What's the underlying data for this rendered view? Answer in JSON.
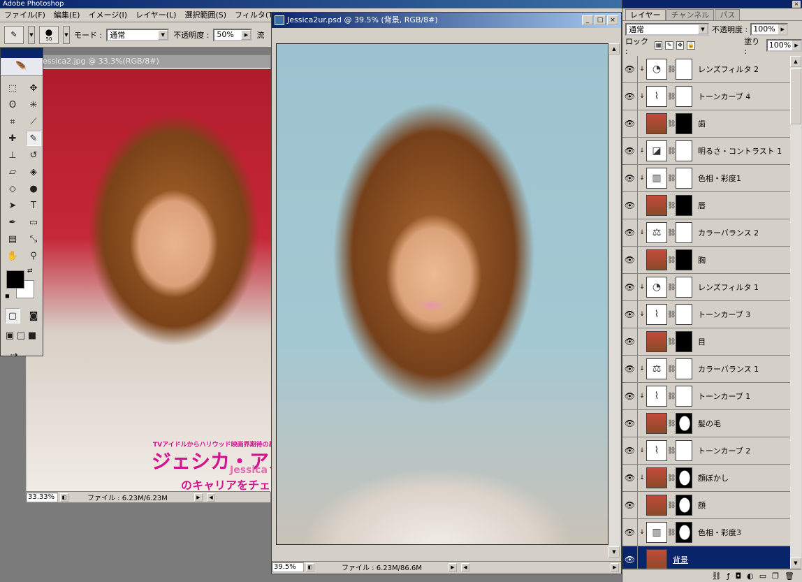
{
  "app": {
    "title": "Adobe Photoshop"
  },
  "menu": [
    "ファイル(F)",
    "編集(E)",
    "イメージ(I)",
    "レイヤー(L)",
    "選択範囲(S)",
    "フィルタ(T)"
  ],
  "options": {
    "brush_size": "50",
    "mode_label": "モード :",
    "mode_value": "通常",
    "opacity_label": "不透明度 :",
    "opacity_value": "50%",
    "flow_label": "流"
  },
  "doc1": {
    "title": "essica2.jpg @ 33.3%(RGB/8#)",
    "zoom": "33.33%",
    "file_info": "ファイル : 6.23M/6.23M",
    "magazine": {
      "small": "TVアイドルからハリウッド映画界期待の星",
      "big": "ジェシカ・アル",
      "english": "Jessica A",
      "sub": "のキャリアをチェッ"
    }
  },
  "doc2": {
    "title": "Jessica2ur.psd @ 39.5% (背景, RGB/8#)",
    "zoom": "39.5%",
    "file_info": "ファイル : 6.23M/86.6M"
  },
  "layers_panel": {
    "tabs": [
      "レイヤー",
      "チャンネル",
      "パス"
    ],
    "blend_mode": "通常",
    "opacity_label": "不透明度 :",
    "opacity_value": "100%",
    "lock_label": "ロック :",
    "fill_label": "塗り :",
    "fill_value": "100%",
    "layers": [
      {
        "name": "レンズフィルタ 2",
        "kind": "adj",
        "icon": "lens-filter-icon",
        "mask": "white",
        "clipped": true
      },
      {
        "name": "トーンカーブ 4",
        "kind": "adj",
        "icon": "curves-icon",
        "mask": "white",
        "clipped": true
      },
      {
        "name": "歯",
        "kind": "img",
        "icon": "photo-thumbnail",
        "mask": "black",
        "clipped": false
      },
      {
        "name": "明るさ・コントラスト 1",
        "kind": "adj",
        "icon": "brightness-contrast-icon",
        "mask": "white",
        "clipped": true
      },
      {
        "name": "色相・彩度1",
        "kind": "adj",
        "icon": "hue-saturation-icon",
        "mask": "white",
        "clipped": true
      },
      {
        "name": "唇",
        "kind": "img",
        "icon": "photo-thumbnail",
        "mask": "black",
        "clipped": false
      },
      {
        "name": "カラーバランス 2",
        "kind": "adj",
        "icon": "color-balance-icon",
        "mask": "white",
        "clipped": true
      },
      {
        "name": "胸",
        "kind": "img",
        "icon": "photo-thumbnail",
        "mask": "black",
        "clipped": false
      },
      {
        "name": "レンズフィルタ 1",
        "kind": "adj",
        "icon": "lens-filter-icon",
        "mask": "white",
        "clipped": true
      },
      {
        "name": "トーンカーブ 3",
        "kind": "adj",
        "icon": "curves-icon",
        "mask": "white",
        "clipped": true
      },
      {
        "name": "目",
        "kind": "img",
        "icon": "photo-thumbnail",
        "mask": "black",
        "clipped": false
      },
      {
        "name": "カラーバランス 1",
        "kind": "adj",
        "icon": "color-balance-icon",
        "mask": "white",
        "clipped": true
      },
      {
        "name": "トーンカーブ 1",
        "kind": "adj",
        "icon": "curves-icon",
        "mask": "white",
        "clipped": true
      },
      {
        "name": "髪の毛",
        "kind": "img",
        "icon": "photo-thumbnail",
        "mask": "shape",
        "clipped": false
      },
      {
        "name": "トーンカーブ 2",
        "kind": "adj",
        "icon": "curves-icon",
        "mask": "white",
        "clipped": true
      },
      {
        "name": "顔ぼかし",
        "kind": "img",
        "icon": "photo-thumbnail",
        "mask": "shape",
        "clipped": true
      },
      {
        "name": "顔",
        "kind": "img",
        "icon": "photo-thumbnail",
        "mask": "shape",
        "clipped": false
      },
      {
        "name": "色相・彩度3",
        "kind": "adj",
        "icon": "hue-saturation-icon",
        "mask": "shape",
        "clipped": true
      },
      {
        "name": "背景",
        "kind": "img",
        "icon": "photo-thumbnail",
        "mask": "none",
        "clipped": false,
        "selected": true
      }
    ]
  }
}
